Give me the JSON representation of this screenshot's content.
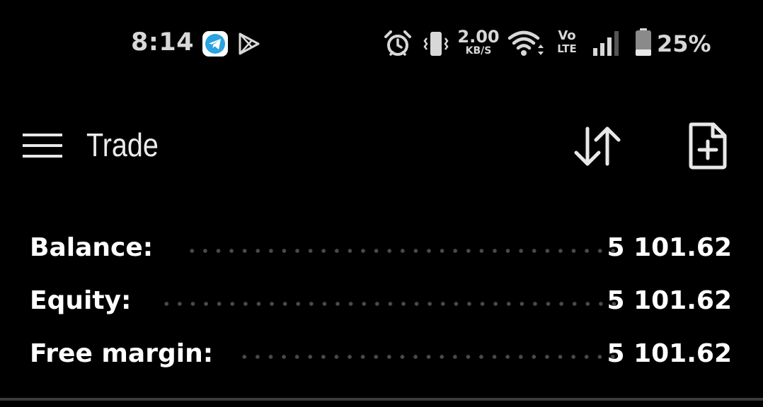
{
  "status_bar": {
    "time": "8:14",
    "notification_icons": [
      "telegram-icon",
      "play-icon"
    ],
    "system_icons": [
      "alarm-icon",
      "vibrate-icon",
      "wifi-icon",
      "signal-icon",
      "battery-icon"
    ],
    "net_speed_value": "2.00",
    "net_speed_unit": "KB/S",
    "volte_top": "Vo",
    "volte_bottom": "LTE",
    "battery_percent": "25%",
    "battery_level": 0.25
  },
  "toolbar": {
    "title": "Trade",
    "icons": [
      "menu-icon",
      "sort-arrows-icon",
      "new-document-icon"
    ]
  },
  "summary": {
    "rows": [
      {
        "label": "Balance:",
        "value": "5 101.62"
      },
      {
        "label": "Equity:",
        "value": "5 101.62"
      },
      {
        "label": "Free margin:",
        "value": "5 101.62"
      }
    ]
  },
  "colors": {
    "background": "#000000",
    "text": "#ffffff",
    "status_text": "#d8d8d8",
    "telegram_blue": "#2aa3e0",
    "dots": "#4a4a4a"
  }
}
